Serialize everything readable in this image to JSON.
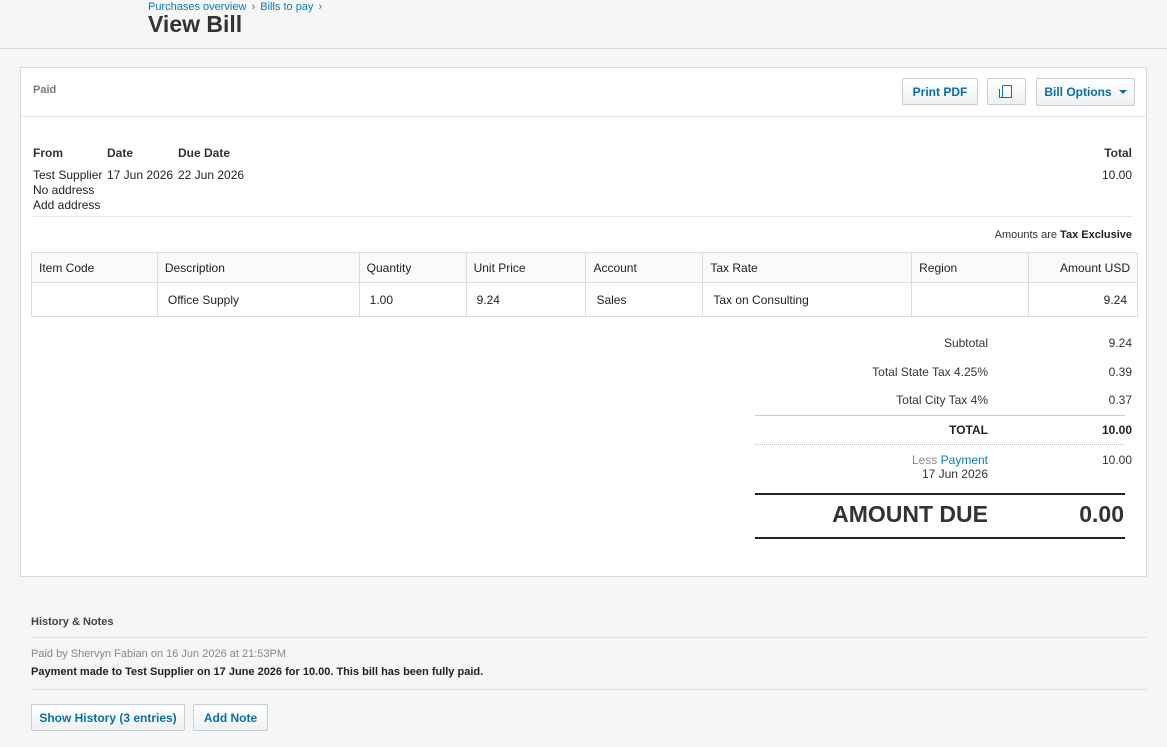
{
  "breadcrumb": {
    "items": [
      "Purchases overview",
      "Bills to pay"
    ],
    "sep": "›"
  },
  "page_title": "View Bill",
  "bill": {
    "status": "Paid",
    "buttons": {
      "print": "Print PDF",
      "copy_icon": "copy-document-icon",
      "options": "Bill Options"
    },
    "headers": {
      "from": "From",
      "date": "Date",
      "due_date": "Due Date",
      "total": "Total"
    },
    "from_name": "Test Supplier",
    "no_address": "No address",
    "add_address": "Add address",
    "date": "17 Jun 2026",
    "due_date": "22 Jun 2026",
    "total": "10.00",
    "amounts_prefix": "Amounts are",
    "amounts_mode": "Tax Exclusive"
  },
  "line_items": {
    "columns": [
      "Item Code",
      "Description",
      "Quantity",
      "Unit Price",
      "Account",
      "Tax Rate",
      "Region",
      "Amount USD"
    ],
    "rows": [
      [
        "",
        "Office Supply",
        "1.00",
        "9.24",
        "Sales",
        "Tax on Consulting",
        "",
        "9.24"
      ]
    ]
  },
  "totals": {
    "subtotal_label": "Subtotal",
    "subtotal": "9.24",
    "state_tax_label": "Total State Tax 4.25%",
    "state_tax": "0.39",
    "city_tax_label": "Total City Tax 4%",
    "city_tax": "0.37",
    "total_label": "TOTAL",
    "total": "10.00",
    "less_label": "Less",
    "payment_link": "Payment",
    "payment_date": "17 Jun 2026",
    "payment_amount": "10.00",
    "amount_due_label": "AMOUNT DUE",
    "amount_due": "0.00"
  },
  "history": {
    "title": "History & Notes",
    "meta": "Paid by Shervyn Fabian on 16 Jun 2026 at 21:53PM",
    "note": "Payment made to Test Supplier on 17 June 2026 for 10.00. This bill has been fully paid.",
    "show_history": "Show History (3 entries)",
    "add_note": "Add Note"
  },
  "colors": {
    "link": "#0a7bb3",
    "button_text": "#0a6fa3",
    "background": "#f6f6f6"
  }
}
